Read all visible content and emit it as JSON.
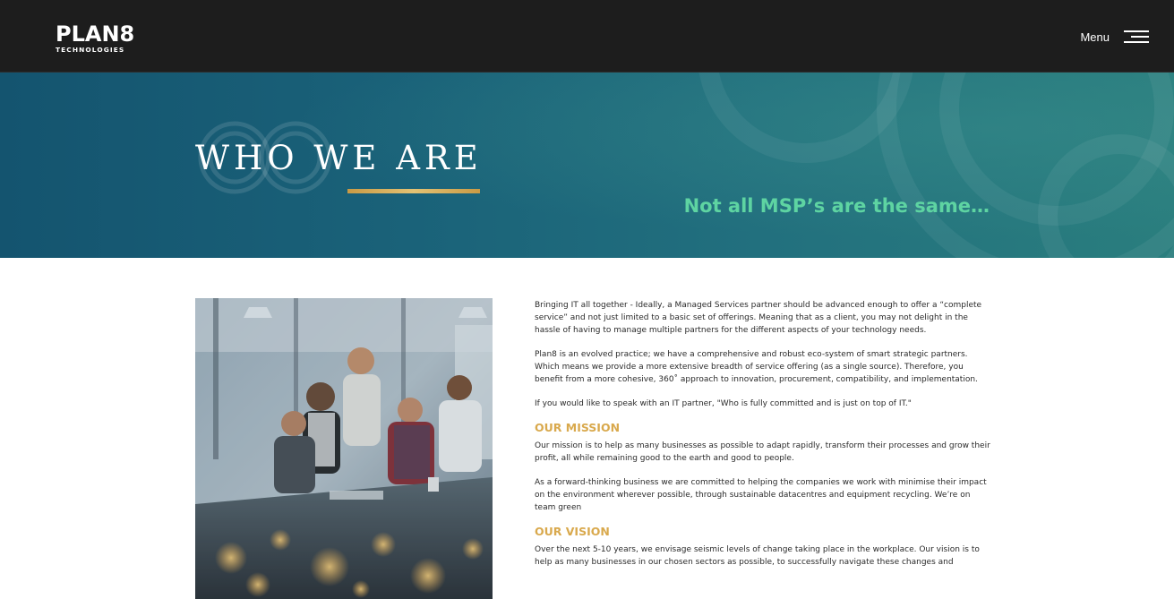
{
  "header": {
    "logo_main": "PLAN8",
    "logo_sub": "TECHNOLOGIES",
    "menu_label": "Menu"
  },
  "hero": {
    "title": "WHO WE ARE",
    "tagline": "Not all MSP’s are the same…"
  },
  "content": {
    "intro_paragraphs": [
      "Bringing IT all together - Ideally, a Managed Services partner should be advanced enough to offer a “complete service” and not just limited to a basic set of offerings. Meaning that as a client, you may not delight in the hassle of having to manage multiple partners for the different aspects of your technology needs.",
      "Plan8 is an evolved practice; we have a comprehensive and robust eco-system of smart strategic partners. Which means we provide a more extensive breadth of service offering (as a single source). Therefore, you benefit from a more cohesive, 360˚ approach to innovation, procurement, compatibility, and implementation.",
      "If you would like to speak with an IT partner, \"Who is fully committed and is just on top of IT.\""
    ],
    "mission": {
      "heading": "OUR MISSION",
      "paragraphs": [
        "Our mission is to help as many businesses as possible to adapt rapidly, transform their processes and grow their profit, all while remaining good to the earth and good to people.",
        "As a forward-thinking business we are committed to helping the companies we work with minimise their impact on the environment wherever possible, through sustainable datacentres and equipment recycling. We’re on team green"
      ]
    },
    "vision": {
      "heading": "OUR VISION",
      "paragraphs": [
        "Over the next 5-10 years, we envisage seismic levels of change taking place in the workplace. Our vision is to help as many businesses in our chosen sectors as possible, to successfully navigate these changes and"
      ]
    }
  },
  "colors": {
    "header_bg": "#1d1d1d",
    "hero_teal": "#1a6279",
    "tagline_green": "#5ed4a2",
    "gold_accent": "#d9a94d"
  },
  "icons": {
    "menu": "hamburger-icon"
  }
}
